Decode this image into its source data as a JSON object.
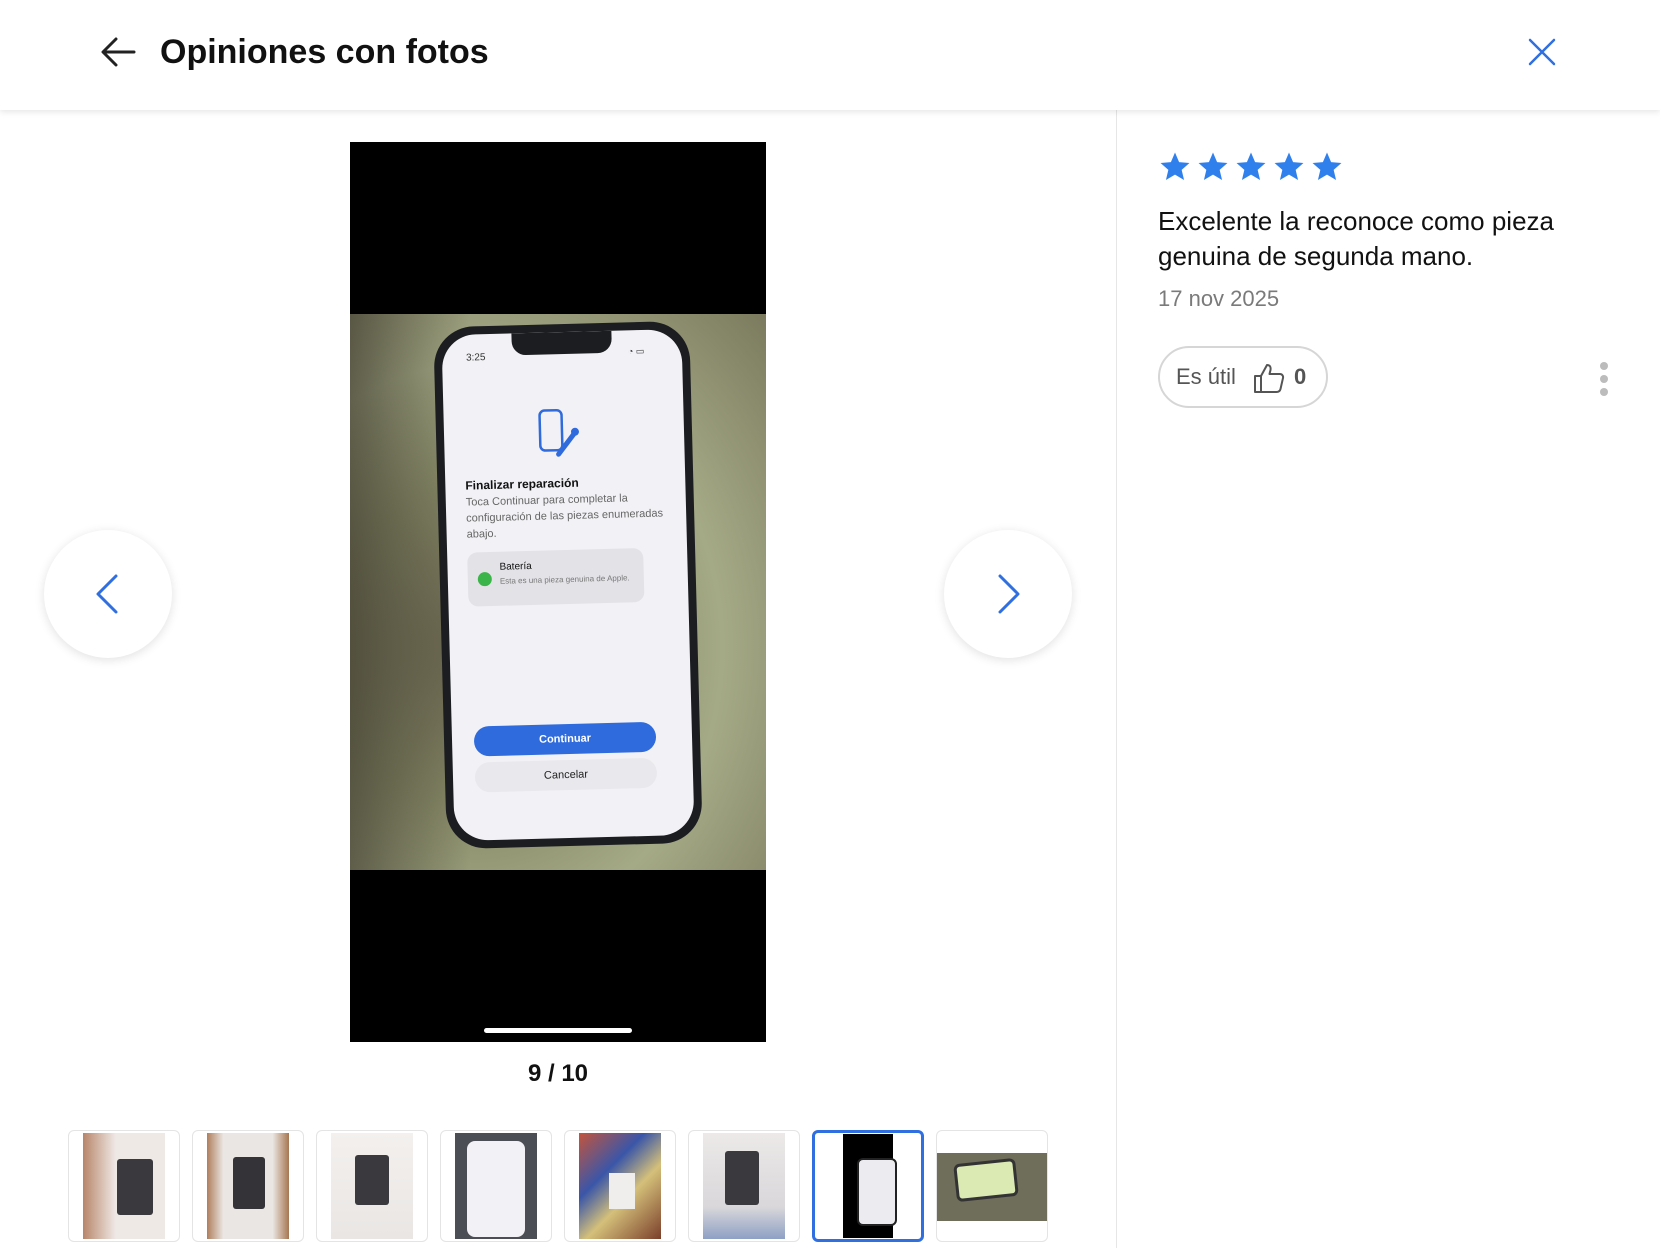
{
  "header": {
    "title": "Opiniones con fotos"
  },
  "icons": {
    "back": "arrow-left-icon",
    "close": "close-icon",
    "prev": "chevron-left-icon",
    "next": "chevron-right-icon",
    "star": "star-icon",
    "helpful": "thumbs-up-icon",
    "more": "more-vertical-icon"
  },
  "colors": {
    "accent": "#2f6fe0",
    "star": "#2f80ed"
  },
  "gallery": {
    "counter": "9 / 10",
    "current_index": 9,
    "total": 10,
    "photo_screen": {
      "time": "3:25",
      "title": "Finalizar reparación",
      "description": "Toca Continuar para completar la configuración de las piezas enumeradas abajo.",
      "card_title": "Batería",
      "card_description": "Esta es una pieza genuina de Apple.",
      "continue_label": "Continuar",
      "cancel_label": "Cancelar"
    },
    "thumbnails": [
      {
        "type": "box-brown"
      },
      {
        "type": "box-wood"
      },
      {
        "type": "box"
      },
      {
        "type": "phone"
      },
      {
        "type": "colorful"
      },
      {
        "type": "box-blue"
      },
      {
        "type": "dark",
        "active": true
      },
      {
        "type": "green"
      }
    ]
  },
  "review": {
    "rating": 5,
    "max_rating": 5,
    "text": "Excelente la reconoce como pieza genuina de segunda mano.",
    "date": "17 nov 2025",
    "helpful_label": "Es útil",
    "helpful_count": "0"
  }
}
